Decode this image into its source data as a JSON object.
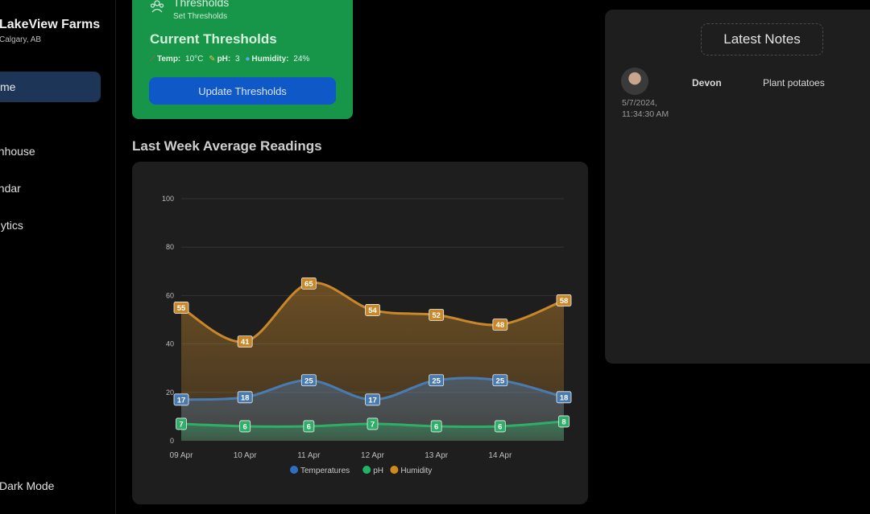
{
  "sidebar": {
    "farm_name": "LakeView Farms",
    "location": "Calgary, AB",
    "items": [
      {
        "label": "me",
        "active": true
      },
      {
        "label": "enhouse"
      },
      {
        "label": "endar"
      },
      {
        "label": "alytics"
      }
    ],
    "dark_mode_label": "Dark Mode"
  },
  "thresholds": {
    "title": "Thresholds",
    "subtitle": "Set Thresholds",
    "current_title": "Current Thresholds",
    "temp_label": "Temp:",
    "temp_value": "10°C",
    "ph_label": "pH:",
    "ph_value": "3",
    "humidity_label": "Humidity:",
    "humidity_value": "24%",
    "button_label": "Update Thresholds",
    "icons": [
      "group-icon",
      "thermometer-icon",
      "pencil-icon",
      "droplet-icon"
    ],
    "colors": {
      "card": "#17964a",
      "button": "#0f58c8"
    }
  },
  "chart_section": {
    "title": "Last Week Average Readings"
  },
  "chart_data": {
    "type": "line",
    "title": "",
    "xlabel": "",
    "ylabel": "",
    "categories": [
      "09 Apr",
      "10 Apr",
      "11 Apr",
      "12 Apr",
      "13 Apr",
      "14 Apr",
      ""
    ],
    "ylim": [
      0,
      100
    ],
    "yticks": [
      0,
      20,
      40,
      60,
      80,
      100
    ],
    "grid": true,
    "legend_position": "bottom",
    "series": [
      {
        "name": "Humidity",
        "values": [
          55,
          41,
          65,
          54,
          52,
          48,
          58
        ],
        "color": "#c8882a"
      },
      {
        "name": "Temperatures",
        "values": [
          17,
          18,
          25,
          17,
          25,
          25,
          18
        ],
        "color": "#4a7bb0"
      },
      {
        "name": "pH",
        "values": [
          7,
          6,
          6,
          7,
          6,
          6,
          8
        ],
        "color": "#2fae6a"
      }
    ],
    "legend": [
      {
        "name": "Temperatures",
        "color": "#2f6fc0"
      },
      {
        "name": "pH",
        "color": "#1fb46a"
      },
      {
        "name": "Humidity",
        "color": "#d08a1c"
      }
    ]
  },
  "notes": {
    "title": "Latest Notes",
    "items": [
      {
        "timestamp": "5/7/2024,",
        "time": "11:34:30 AM",
        "author": "Devon",
        "text": "Plant potatoes"
      }
    ]
  }
}
